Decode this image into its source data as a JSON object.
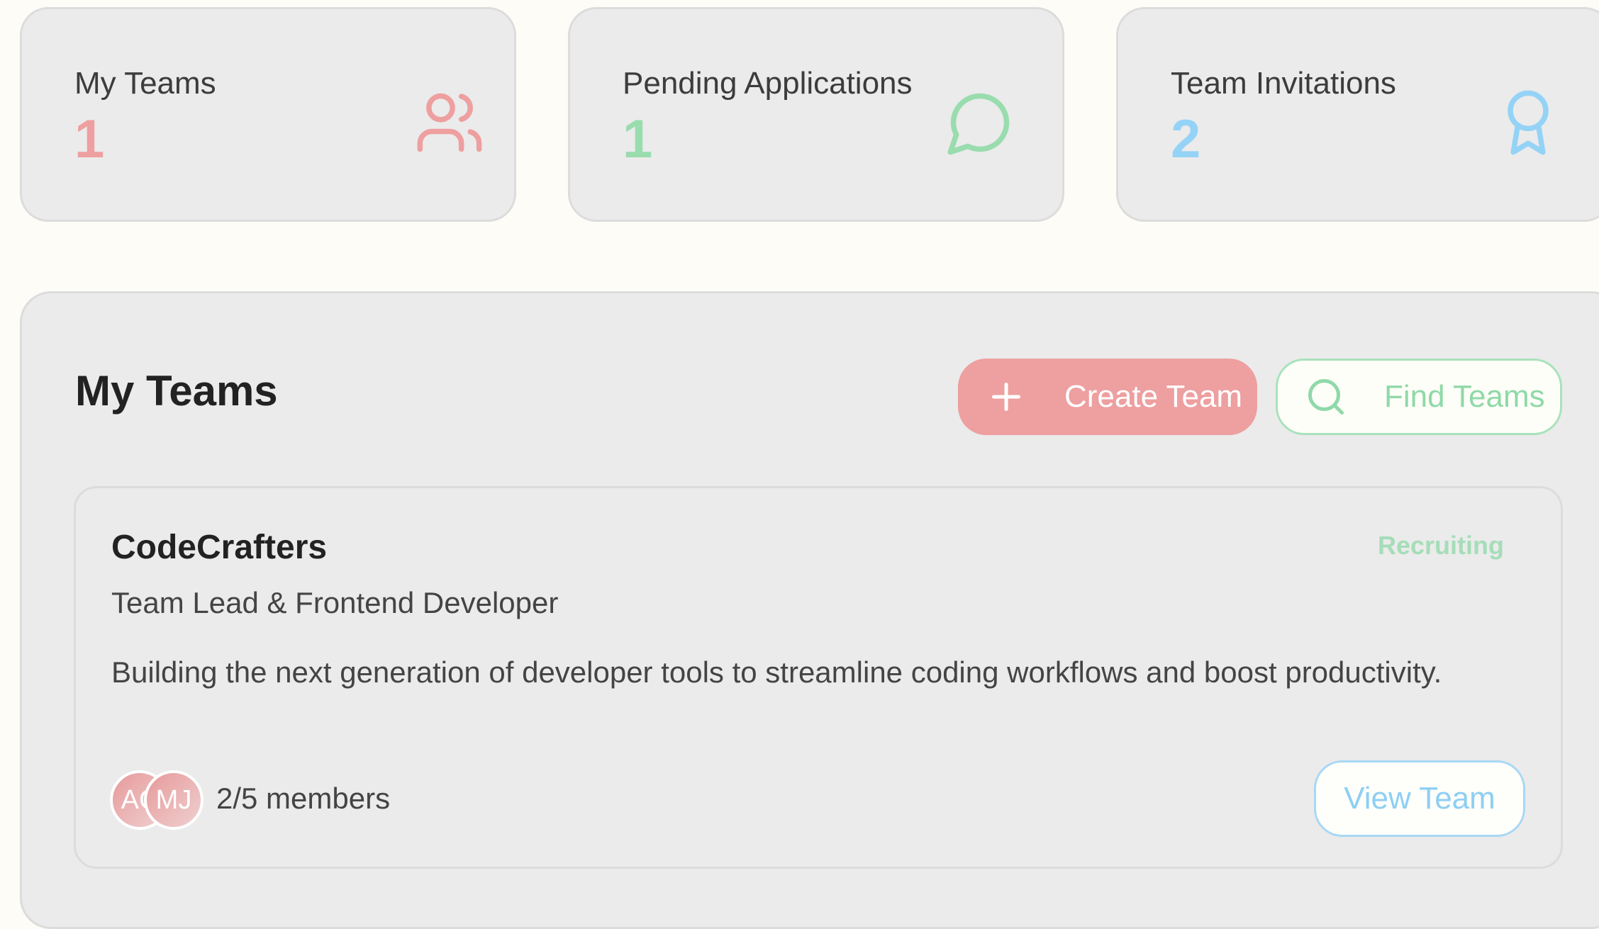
{
  "stats": [
    {
      "label": "My Teams",
      "value": "1",
      "color": "#ee9fa0",
      "icon": "users-icon"
    },
    {
      "label": "Pending Applications",
      "value": "1",
      "color": "#99dcae",
      "icon": "message-circle-icon"
    },
    {
      "label": "Team Invitations",
      "value": "2",
      "color": "#94d3f6",
      "icon": "award-icon"
    }
  ],
  "panel": {
    "title": "My Teams",
    "create_label": "Create Team",
    "find_label": "Find Teams"
  },
  "team": {
    "name": "CodeCrafters",
    "status": "Recruiting",
    "role": "Team Lead & Frontend Developer",
    "description": "Building the next generation of developer tools to streamline coding workflows and boost productivity.",
    "avatars": [
      "AC",
      "MJ"
    ],
    "members": "2/5 members",
    "view_label": "View Team"
  }
}
